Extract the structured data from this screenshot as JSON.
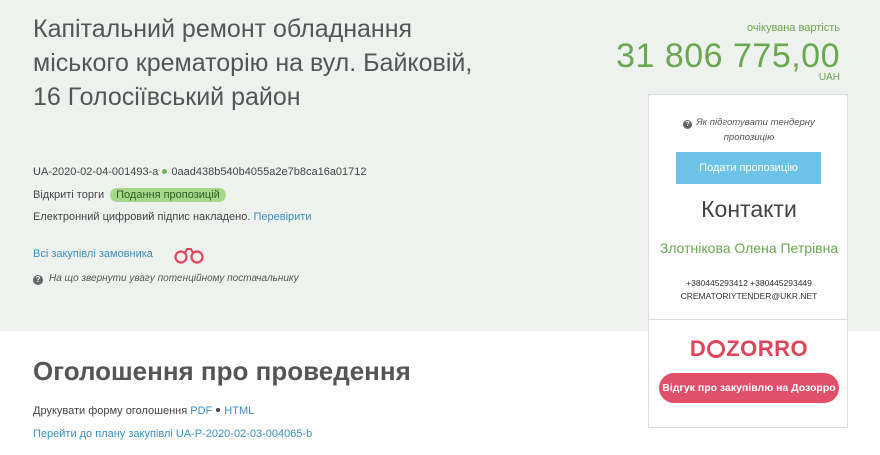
{
  "tender": {
    "title": "Капітальний ремонт обладнання міського крематорію на вул. Байковій, 16 Голосіївський район",
    "id": "UA-2020-02-04-001493-a",
    "hash": "0aad438b540b4055a2e7b8ca16a01712",
    "procedure_type": "Відкриті торги",
    "status": "Подання пропозицій",
    "signature_text": "Електронний цифровий підпис накладено.",
    "signature_link": "Перевірити",
    "all_purchases_link": "Всі закупівлі замовника",
    "attention_text": "На що звернути увагу потенційному постачальнику"
  },
  "price": {
    "label": "очікувана вартість",
    "value": "31 806 775,00",
    "currency": "UAH"
  },
  "panel": {
    "howto_text": "Як підготувати тендерну пропозицію",
    "submit_button": "Подати пропозицію",
    "contacts_title": "Контакти",
    "contact_name": "Злотнікова Олена Петрівна",
    "contact_phones": "+380445293412 +380445293449",
    "contact_email": "CREMATORIYTENDER@UKR.NET",
    "dozorro_logo_parts": [
      "D",
      "ZORRO"
    ],
    "dozorro_button": "Відгук про закупівлю на Дозорро"
  },
  "announcement": {
    "title": "Оголошення про проведення",
    "print_text": "Друкувати форму оголошення",
    "pdf_link": "PDF",
    "html_link": "HTML",
    "plan_link": "Перейти до плану закупівлі UA-P-2020-02-03-004065-b"
  },
  "colors": {
    "accent_green": "#6aa84f",
    "link_blue": "#3a8fc4",
    "dozorro_red": "#e0455c",
    "submit_blue": "#6dc3e7"
  }
}
